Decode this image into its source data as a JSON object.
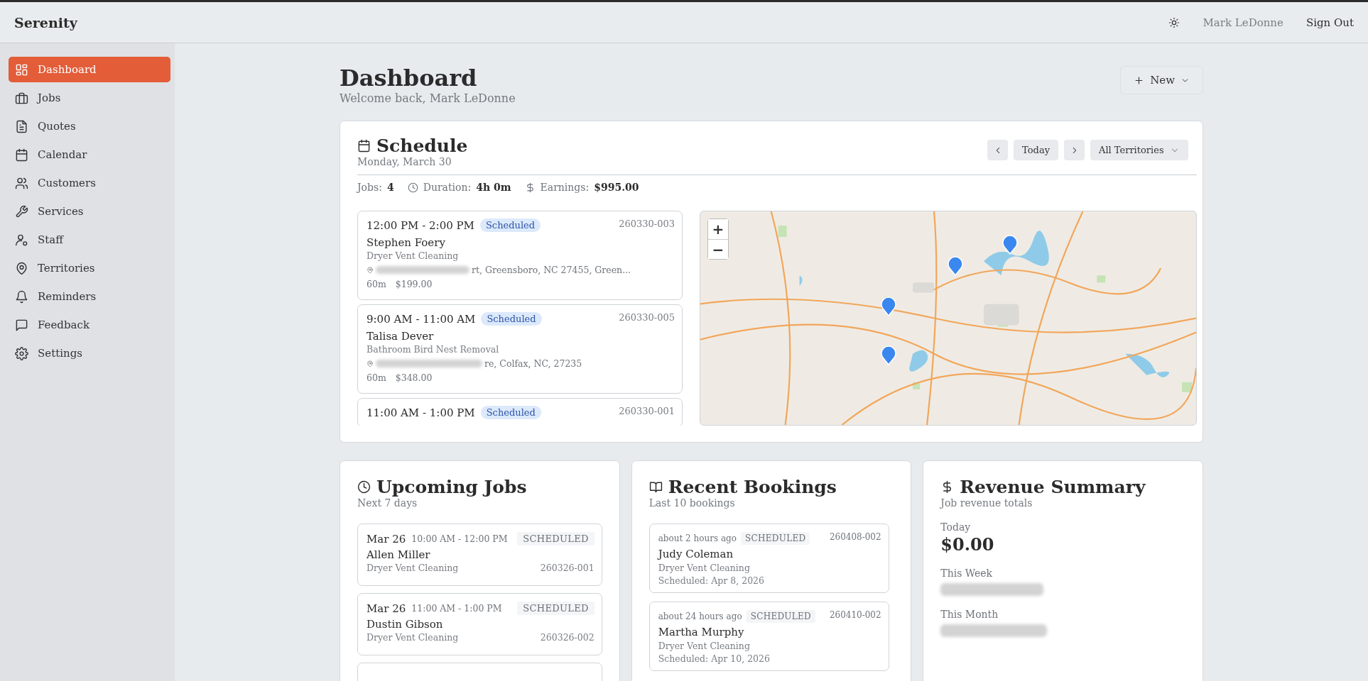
{
  "header": {
    "brand": "Serenity",
    "user": "Mark LeDonne",
    "sign_out": "Sign Out"
  },
  "sidebar": {
    "items": [
      {
        "label": "Dashboard",
        "selected": true
      },
      {
        "label": "Jobs",
        "selected": false
      },
      {
        "label": "Quotes",
        "selected": false
      },
      {
        "label": "Calendar",
        "selected": false
      },
      {
        "label": "Customers",
        "selected": false
      },
      {
        "label": "Services",
        "selected": false
      },
      {
        "label": "Staff",
        "selected": false
      },
      {
        "label": "Territories",
        "selected": false
      },
      {
        "label": "Reminders",
        "selected": false
      },
      {
        "label": "Feedback",
        "selected": false
      },
      {
        "label": "Settings",
        "selected": false
      }
    ]
  },
  "page": {
    "title": "Dashboard",
    "subtitle": "Welcome back, Mark LeDonne",
    "new_button": "New"
  },
  "schedule": {
    "title": "Schedule",
    "date": "Monday, March 30",
    "today_button": "Today",
    "territory_select": "All Territories",
    "stats": [
      {
        "label": "Jobs:",
        "value": "4"
      },
      {
        "label": "Duration:",
        "value": "4h 0m"
      },
      {
        "label": "Earnings:",
        "value": "$995.00"
      }
    ],
    "jobs": [
      {
        "time": "12:00 PM - 2:00 PM",
        "status": "Scheduled",
        "number": "260330-003",
        "customer": "Stephen Foery",
        "service": "Dryer Vent Cleaning",
        "address": "rt, Greensboro, NC 27455, Green...",
        "redacted": true,
        "duration": "60m",
        "price": "$199.00"
      },
      {
        "time": "9:00 AM - 11:00 AM",
        "status": "Scheduled",
        "number": "260330-005",
        "customer": "Talisa Dever",
        "service": "Bathroom Bird Nest Removal",
        "address": "re, Colfax, NC, 27235",
        "redacted": true,
        "duration": "60m",
        "price": "$348.00"
      },
      {
        "time": "11:00 AM - 1:00 PM",
        "status": "Scheduled",
        "number": "260330-001"
      }
    ],
    "map": {
      "zoom_in": "+",
      "zoom_out": "−"
    }
  },
  "upcoming": {
    "title": "Upcoming Jobs",
    "subtitle": "Next 7 days",
    "jobs": [
      {
        "date": "Mar 26",
        "time": "10:00 AM - 12:00 PM",
        "status": "SCHEDULED",
        "customer": "Allen Miller",
        "service": "Dryer Vent Cleaning",
        "number": "260326-001"
      },
      {
        "date": "Mar 26",
        "time": "11:00 AM - 1:00 PM",
        "status": "SCHEDULED",
        "customer": "Dustin Gibson",
        "service": "Dryer Vent Cleaning",
        "number": "260326-002"
      }
    ]
  },
  "bookings": {
    "title": "Recent Bookings",
    "subtitle": "Last 10 bookings",
    "items": [
      {
        "ago": "about 2 hours ago",
        "status": "SCHEDULED",
        "number": "260408-002",
        "customer": "Judy Coleman",
        "service": "Dryer Vent Cleaning",
        "scheduled": "Scheduled: Apr 8, 2026"
      },
      {
        "ago": "about 24 hours ago",
        "status": "SCHEDULED",
        "number": "260410-002",
        "customer": "Martha Murphy",
        "service": "Dryer Vent Cleaning",
        "scheduled": "Scheduled: Apr 10, 2026"
      }
    ]
  },
  "revenue": {
    "title": "Revenue Summary",
    "subtitle": "Job revenue totals",
    "periods": [
      {
        "label": "Today",
        "value": "$0.00",
        "redacted": false
      },
      {
        "label": "This Week",
        "redacted": true
      },
      {
        "label": "This Month",
        "redacted": true
      }
    ]
  }
}
